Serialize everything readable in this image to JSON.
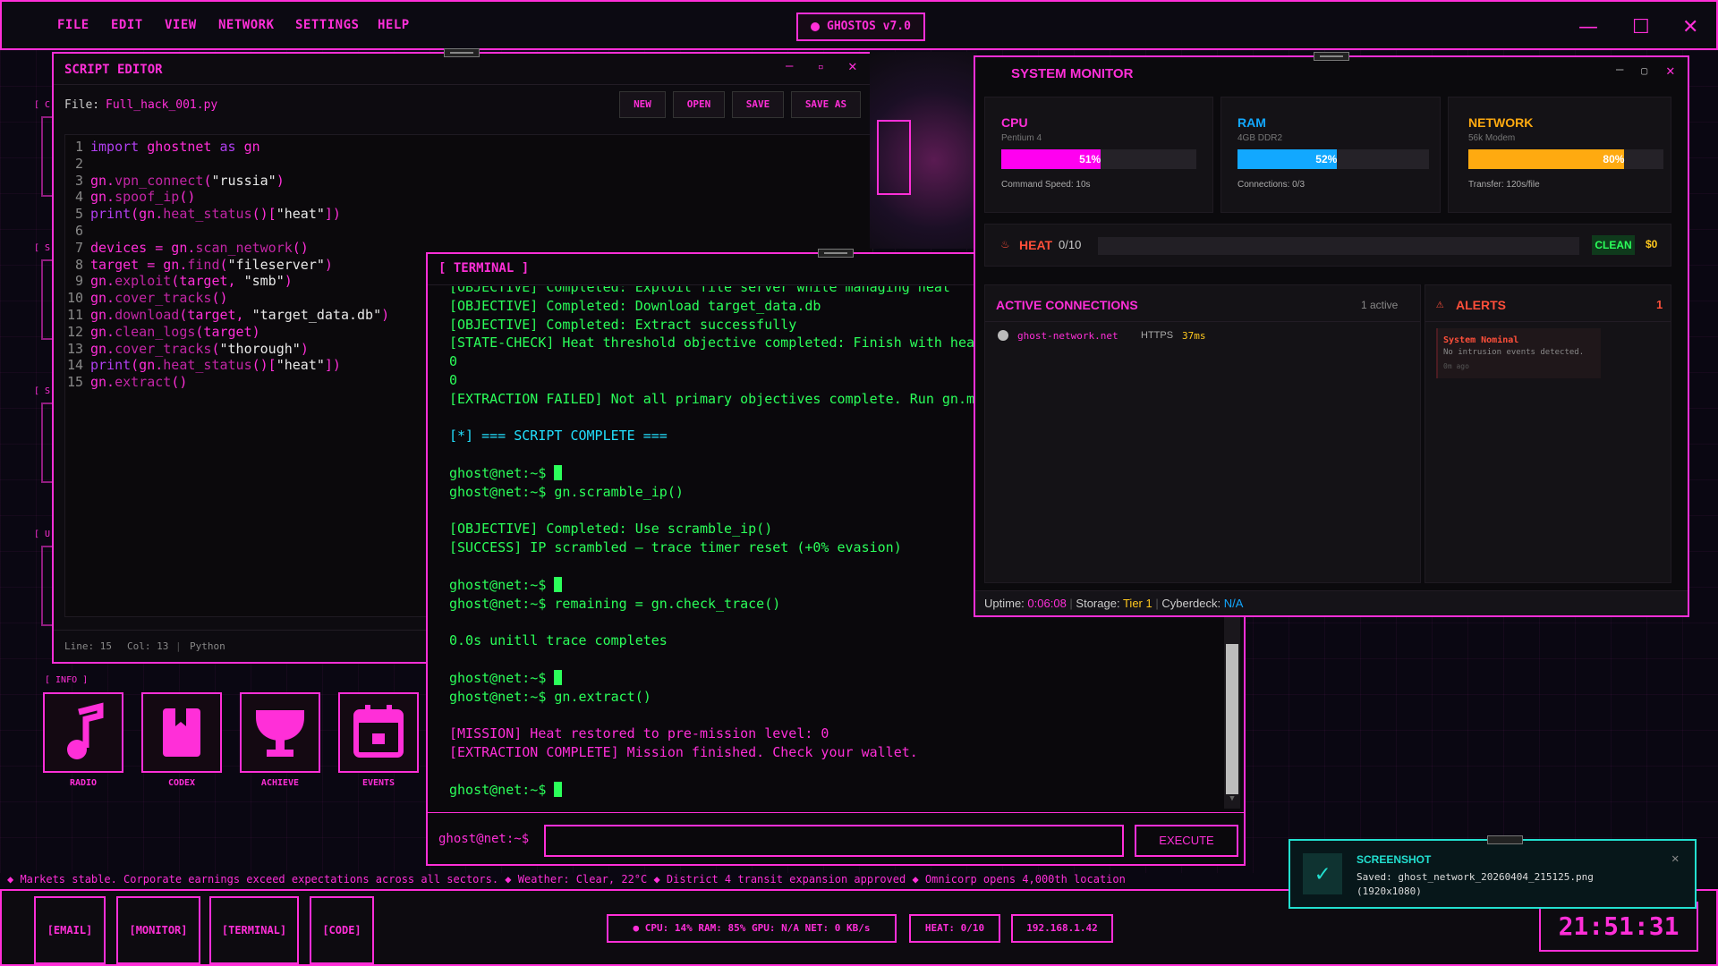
{
  "menubar": {
    "items": [
      "FILE",
      "EDIT",
      "VIEW",
      "NETWORK",
      "SETTINGS",
      "HELP"
    ],
    "os_badge": "GHOSTOS v7.0",
    "minimize": "—",
    "maximize": "☐",
    "close": "✕"
  },
  "editor": {
    "title": "SCRIPT EDITOR",
    "file_label": "File:",
    "file_name": "Full_hack_001.py",
    "buttons": [
      "NEW",
      "OPEN",
      "SAVE",
      "SAVE AS"
    ],
    "code": [
      {
        "n": "1",
        "t": "import ghostnet as gn"
      },
      {
        "n": "2",
        "t": ""
      },
      {
        "n": "3",
        "t": "gn.vpn_connect(\"russia\")"
      },
      {
        "n": "4",
        "t": "gn.spoof_ip()"
      },
      {
        "n": "5",
        "t": "print(gn.heat_status()[\"heat\"])"
      },
      {
        "n": "6",
        "t": ""
      },
      {
        "n": "7",
        "t": "devices = gn.scan_network()"
      },
      {
        "n": "8",
        "t": "target = gn.find(\"fileserver\")"
      },
      {
        "n": "9",
        "t": "gn.exploit(target, \"smb\")"
      },
      {
        "n": "10",
        "t": "gn.cover_tracks()"
      },
      {
        "n": "11",
        "t": "gn.download(target, \"target_data.db\")"
      },
      {
        "n": "12",
        "t": "gn.clean_logs(target)"
      },
      {
        "n": "13",
        "t": "gn.cover_tracks(\"thorough\")"
      },
      {
        "n": "14",
        "t": "print(gn.heat_status()[\"heat\"])"
      },
      {
        "n": "15",
        "t": "gn.extract()"
      }
    ],
    "status_line": "Line: 15",
    "status_col": "Col: 13",
    "status_lang": "Python"
  },
  "terminal": {
    "title": "[ TERMINAL ]",
    "lines": [
      "[OBJECTIVE] Completed: Exploit file server while managing heat",
      "[OBJECTIVE] Completed: Download target_data.db",
      "[OBJECTIVE] Completed: Extract successfully",
      "[STATE-CHECK] Heat threshold objective completed: Finish with heat",
      "0",
      "0",
      "[EXTRACTION FAILED] Not all primary objectives complete. Run gn.mis",
      "",
      "[*] === SCRIPT COMPLETE ===",
      "",
      "ghost@net:~$ ",
      "ghost@net:~$ gn.scramble_ip()",
      "",
      "[OBJECTIVE] Completed: Use scramble_ip()",
      "[SUCCESS] IP scrambled — trace timer reset (+0% evasion)",
      "",
      "ghost@net:~$ ",
      "ghost@net:~$ remaining = gn.check_trace()",
      "",
      "0.0s unitll trace completes",
      "",
      "ghost@net:~$ ",
      "ghost@net:~$ gn.extract()",
      "",
      "[MISSION] Heat restored to pre-mission level: 0",
      "[EXTRACTION COMPLETE] Mission finished. Check your wallet.",
      "",
      "ghost@net:~$ "
    ],
    "prompt": "ghost@net:~$",
    "execute": "EXECUTE"
  },
  "monitor": {
    "title": "SYSTEM MONITOR",
    "cpu": {
      "label": "CPU",
      "sub": "Pentium 4",
      "value": "51%",
      "pct": 0.51,
      "note": "Command Speed: 10s"
    },
    "ram": {
      "label": "RAM",
      "sub": "4GB DDR2",
      "value": "52%",
      "pct": 0.52,
      "note": "Connections: 0/3"
    },
    "net": {
      "label": "NETWORK",
      "sub": "56k Modem",
      "value": "80%",
      "pct": 0.8,
      "note": "Transfer: 120s/file"
    },
    "heat_label": "HEAT",
    "heat_value": "0/10",
    "clean": "CLEAN",
    "money": "$0",
    "conn_title": "ACTIVE CONNECTIONS",
    "conn_count": "1 active",
    "conn_host": "ghost-network.net",
    "conn_proto": "HTTPS",
    "conn_ping": "37ms",
    "alerts_title": "ALERTS",
    "alerts_count": "1",
    "alert_head": "System Nominal",
    "alert_body": "No intrusion events detected.",
    "alert_time": "0m ago",
    "uptime_label": "Uptime:",
    "uptime": "0:06:08",
    "storage_label": "Storage:",
    "storage": "Tier 1",
    "cyber_label": "Cyberdeck:",
    "cyber": "N/A"
  },
  "side_labels": [
    "[ C",
    "[ S",
    "[ S",
    "[ U"
  ],
  "info_label": "[ INFO ]",
  "dock": [
    "RADIO",
    "CODEX",
    "ACHIEVE",
    "EVENTS"
  ],
  "ticker": "◆  Markets stable. Corporate earnings exceed expectations across all sectors.   ◆  Weather: Clear, 22°C   ◆  District 4 transit expansion approved   ◆  Omnicorp opens 4,000th location",
  "taskbar": {
    "buttons": [
      "[EMAIL]",
      "[MONITOR]",
      "[TERMINAL]",
      "[CODE]"
    ],
    "stats": "●  CPU: 14%  RAM: 85%  GPU: N/A  NET: 0 KB/s",
    "heat": "HEAT: 0/10",
    "ip": "192.168.1.42",
    "clock": "21:51:31"
  },
  "toast": {
    "title": "SCREENSHOT",
    "body": "Saved: ghost_network_20260404_215125.png",
    "size": "(1920x1080)"
  }
}
